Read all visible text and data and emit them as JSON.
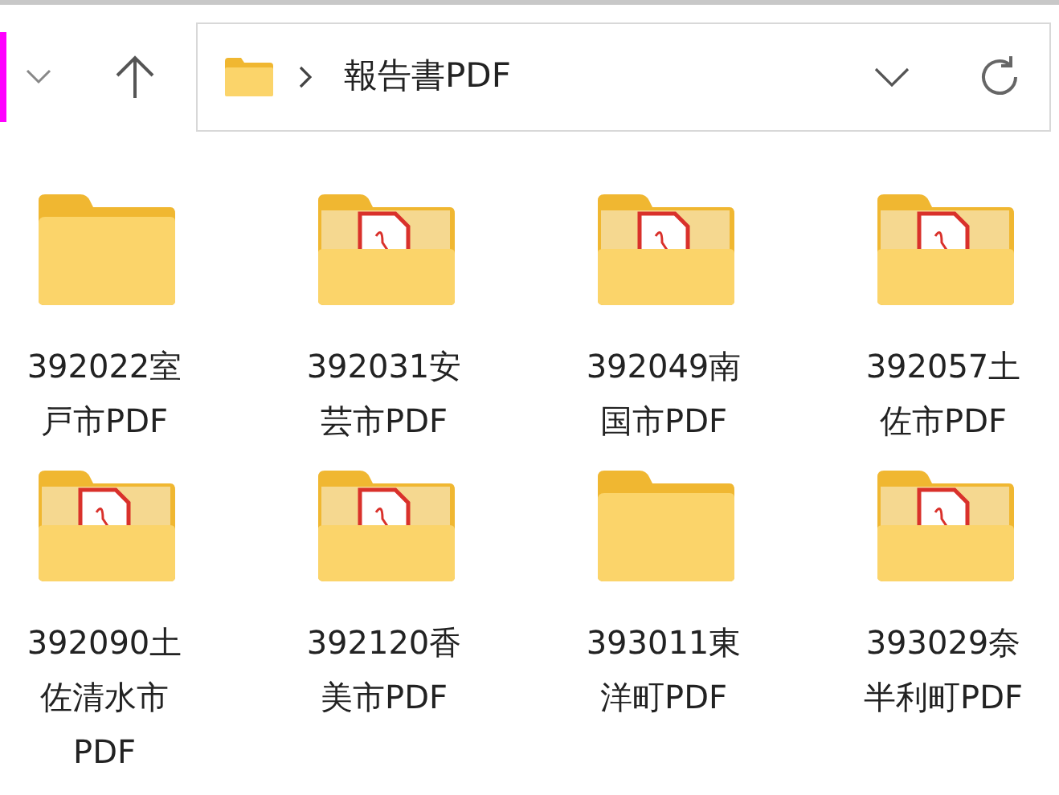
{
  "address_bar": {
    "path": "報告書PDF"
  },
  "folders": [
    {
      "name": "392022室戸市PDF",
      "kind": "empty"
    },
    {
      "name": "392031安芸市PDF",
      "kind": "pdf"
    },
    {
      "name": "392049南国市PDF",
      "kind": "pdf"
    },
    {
      "name": "392057土佐市PDF",
      "kind": "pdf"
    },
    {
      "name": "392090土佐清水市PDF",
      "kind": "pdf"
    },
    {
      "name": "392120香美市PDF",
      "kind": "pdf"
    },
    {
      "name": "393011東洋町PDF",
      "kind": "empty"
    },
    {
      "name": "393029奈半利町PDF",
      "kind": "pdf"
    }
  ]
}
